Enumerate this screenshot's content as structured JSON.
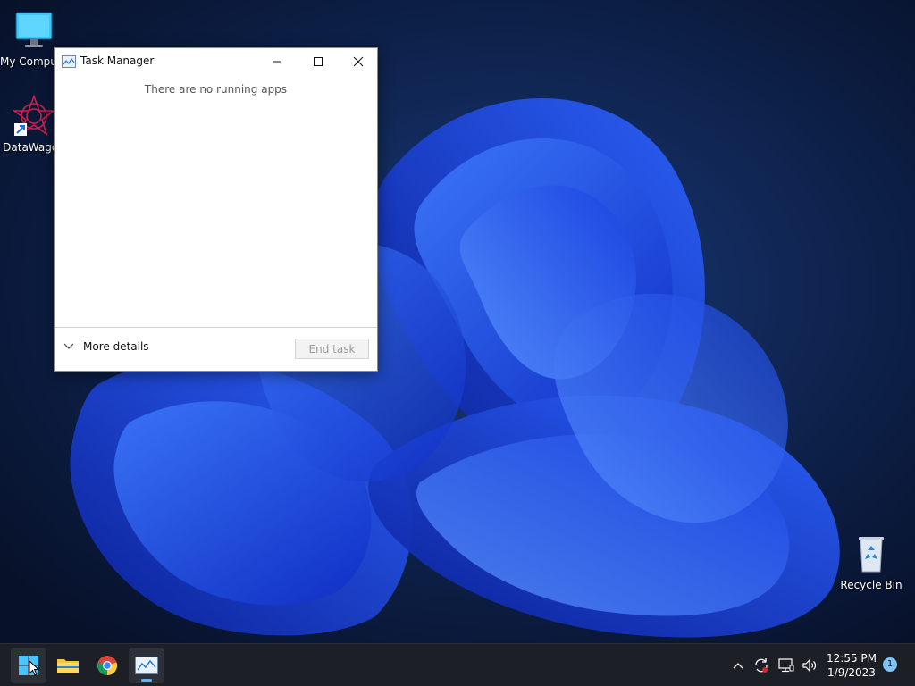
{
  "desktop": {
    "icons": [
      {
        "label": "My Computer",
        "icon": "monitor-icon"
      },
      {
        "label": "DataWagon",
        "icon": "datawagon-icon"
      },
      {
        "label": "Recycle Bin",
        "icon": "recycle-bin-icon"
      }
    ]
  },
  "task_manager": {
    "title": "Task Manager",
    "empty_message": "There are no running apps",
    "more_details_label": "More details",
    "end_task_label": "End task",
    "caption_buttons": [
      "minimize-icon",
      "maximize-icon",
      "close-icon"
    ]
  },
  "taskbar": {
    "pinned": [
      "start-icon",
      "file-explorer-icon",
      "chrome-icon",
      "task-manager-icon"
    ],
    "tray_icons": [
      "chevron-up-icon",
      "sync-icon",
      "network-icon",
      "volume-icon"
    ],
    "time": "12:55 PM",
    "date": "1/9/2023",
    "notification_count": "1"
  },
  "colors": {
    "accent": "#5fb2f2",
    "taskbar": "#1c1f26",
    "wallpaper_dark": "#0a1733",
    "wallpaper_blue": "#1f55ff"
  }
}
